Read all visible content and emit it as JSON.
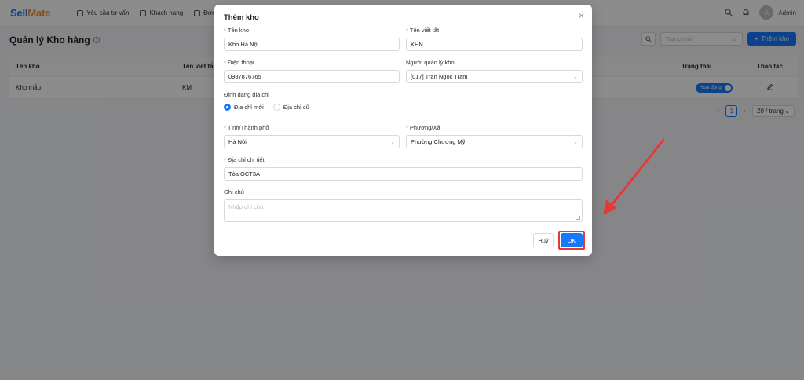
{
  "app": {
    "logo_a": "Sell",
    "logo_b": "Mate"
  },
  "nav": [
    {
      "label": "Yêu cầu tư vấn"
    },
    {
      "label": "Khách hàng"
    },
    {
      "label": "Đơn hà"
    }
  ],
  "header": {
    "avatar": "A",
    "user": "Admin"
  },
  "page": {
    "title": "Quản lý Kho hàng",
    "help": "?"
  },
  "toolbar": {
    "status_placeholder": "Trạng thái",
    "add_label": "Thêm kho"
  },
  "table": {
    "columns": [
      "Tên kho",
      "Tên viết tắ",
      "Trạng thái",
      "Thao tác"
    ],
    "rows": [
      {
        "name": "Kho mẫu",
        "short": "KM",
        "status": "Hoạt động"
      }
    ]
  },
  "pagination": {
    "current": "1",
    "per_page": "20 / trang"
  },
  "modal": {
    "title": "Thêm kho",
    "close": "×",
    "warehouse_name": {
      "label": "Tên kho",
      "value": "Kho Hà Nội"
    },
    "short_name": {
      "label": "Tên viết tắt",
      "value": "KHN"
    },
    "phone": {
      "label": "Điện thoại",
      "value": "0987876765"
    },
    "manager": {
      "label": "Người quản lý kho",
      "value": "[017] Tran Ngoc Tram"
    },
    "address_format": {
      "label": "Định dạng địa chỉ",
      "options": [
        "Địa chỉ mới",
        "Địa chỉ cũ"
      ],
      "selected": "Địa chỉ mới"
    },
    "province": {
      "label": "Tỉnh/Thành phố",
      "value": "Hà Nội"
    },
    "ward": {
      "label": "Phường/Xã",
      "value": "Phường Chương Mỹ"
    },
    "address_detail": {
      "label": "Địa chỉ chi tiết",
      "value": "Tòa OCT3A"
    },
    "note": {
      "label": "Ghi chú",
      "placeholder": "Nhập ghi chú"
    },
    "cancel_label": "Huỷ",
    "ok_label": "OK"
  },
  "colors": {
    "primary": "#1677ff",
    "highlight": "#e53935",
    "required": "#ff4d4f"
  }
}
